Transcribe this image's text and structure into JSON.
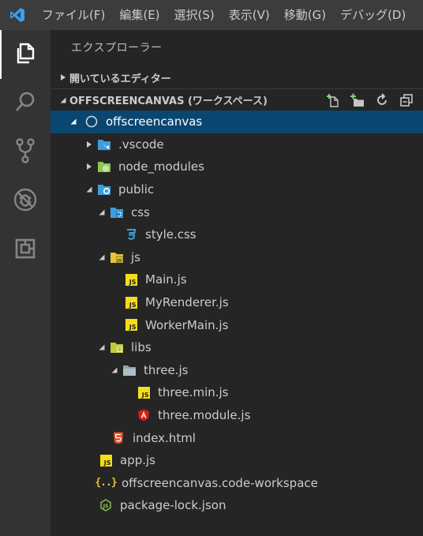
{
  "menu": [
    "ファイル(F)",
    "編集(E)",
    "選択(S)",
    "表示(V)",
    "移動(G)",
    "デバッグ(D)"
  ],
  "sidebar": {
    "title": "エクスプローラー",
    "open_editors": "開いているエディター",
    "workspace": "OFFSCREENCANVAS (ワークスペース)"
  },
  "tree": [
    {
      "label": "offscreencanvas",
      "icon": "root-folder-icon"
    },
    {
      "label": ".vscode",
      "icon": "vscode-folder-icon"
    },
    {
      "label": "node_modules",
      "icon": "node-folder-icon"
    },
    {
      "label": "public",
      "icon": "public-folder-icon"
    },
    {
      "label": "css",
      "icon": "css-folder-icon"
    },
    {
      "label": "style.css",
      "icon": "css-file-icon"
    },
    {
      "label": "js",
      "icon": "js-folder-icon"
    },
    {
      "label": "Main.js",
      "icon": "js-file-icon"
    },
    {
      "label": "MyRenderer.js",
      "icon": "js-file-icon"
    },
    {
      "label": "WorkerMain.js",
      "icon": "js-file-icon"
    },
    {
      "label": "libs",
      "icon": "libs-folder-icon"
    },
    {
      "label": "three.js",
      "icon": "folder-icon"
    },
    {
      "label": "three.min.js",
      "icon": "js-file-icon"
    },
    {
      "label": "three.module.js",
      "icon": "angular-file-icon"
    },
    {
      "label": "index.html",
      "icon": "html-file-icon"
    },
    {
      "label": "app.js",
      "icon": "js-file-icon"
    },
    {
      "label": "offscreencanvas.code-workspace",
      "icon": "workspace-file-icon"
    },
    {
      "label": "package-lock.json",
      "icon": "node-json-file-icon"
    }
  ],
  "js_badge": "JS",
  "json_badge": "{..}",
  "colors": {
    "selection": "#094771",
    "js_yellow": "#f5de19",
    "html_orange": "#e44d26",
    "angular_red": "#dd1b16",
    "css_blue": "#3c9fdd"
  }
}
